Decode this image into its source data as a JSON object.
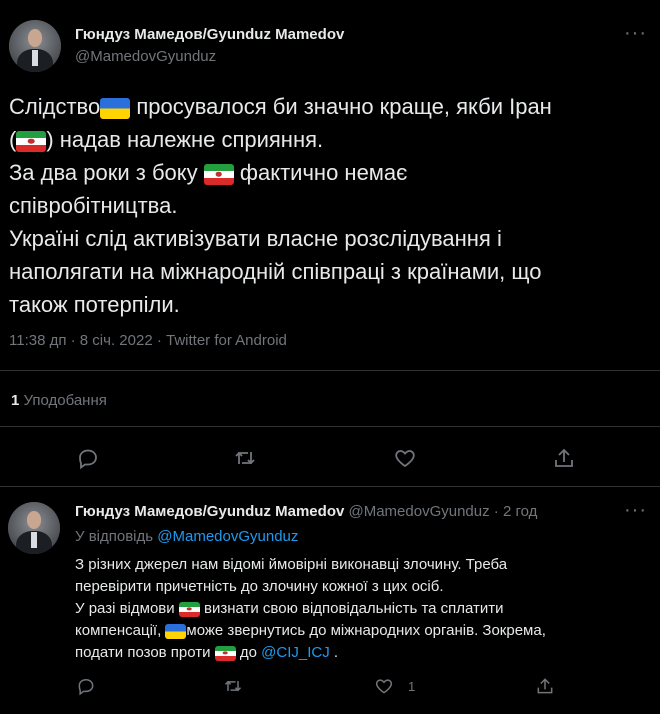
{
  "tweet": {
    "author_name": "Гюндуз Мамедов/Gyunduz Mamedov",
    "author_handle": "@MamedovGyunduz",
    "more_glyph": "···",
    "body": {
      "line1_a": "Слідство",
      "line1_b": " просувалося би значно краще, якби Іран",
      "line2_a": "(",
      "line2_b": ") надав належне сприяння.",
      "line3_a": "За два роки з боку ",
      "line3_b": " фактично немає",
      "line4": "співробітництва.",
      "line5": "Україні слід активізувати власне розслідування і",
      "line6": "наполягати на міжнародній співпраці з країнами, що",
      "line7": "також потерпіли."
    },
    "timestamp": "11:38 дп · 8 січ. 2022 · Twitter for Android",
    "likes_count": "1",
    "likes_label": " Уподобання",
    "actions": [
      "reply-icon",
      "retweet-icon",
      "like-icon",
      "share-icon"
    ]
  },
  "reply": {
    "author_name": "Гюндуз Мамедов/Gyunduz Mamedov",
    "author_handle_time": " @MamedovGyunduz · 2 год",
    "more_glyph": "···",
    "replying_to_label": "У відповідь ",
    "replying_to_handle": "@MamedovGyunduz",
    "body": {
      "line1": "З різних джерел нам відомі ймовірні виконавці злочину. Треба",
      "line2": "перевірити причетність до злочину кожної з цих осіб.",
      "line3_a": "У разі відмови ",
      "line3_b": " визнати свою відповідальність та сплатити",
      "line4_a": "компенсації, ",
      "line4_b": "може звернутись до міжнародних органів. Зокрема,",
      "line5_a": "подати позов проти ",
      "line5_b": " до ",
      "line5_link": "@CIJ_ICJ",
      "line5_c": " ."
    },
    "like_count": "1"
  },
  "colors": {
    "background": "#000000",
    "text": "#e7e9ea",
    "muted": "#71767b",
    "accent": "#1d9bf0",
    "divider": "#2f3336"
  }
}
